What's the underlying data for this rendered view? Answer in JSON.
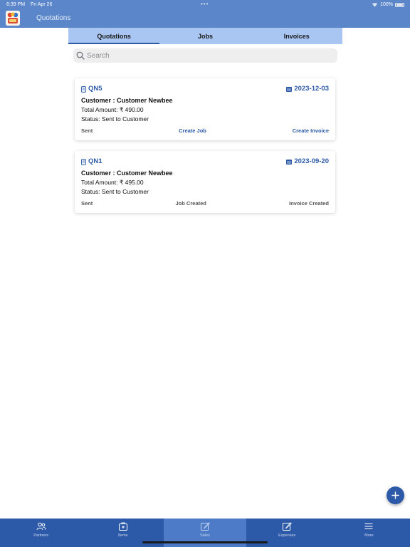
{
  "status_bar": {
    "time": "6:39 PM",
    "date": "Fri Apr 26",
    "battery": "100%"
  },
  "header": {
    "title": "Quotations"
  },
  "tabs": [
    {
      "label": "Quotations",
      "active": true
    },
    {
      "label": "Jobs",
      "active": false
    },
    {
      "label": "Invoices",
      "active": false
    }
  ],
  "search": {
    "placeholder": "Search",
    "value": ""
  },
  "quotations": [
    {
      "id": "QN5",
      "date": "2023-12-03",
      "customer": "Customer : Customer Newbee",
      "amount": "Total Amount: ₹ 490.00",
      "status": "Status: Sent to Customer",
      "footer_left": "Sent",
      "footer_mid": "Create Job",
      "footer_right": "Create Invoice"
    },
    {
      "id": "QN1",
      "date": "2023-09-20",
      "customer": "Customer : Customer Newbee",
      "amount": "Total Amount: ₹ 495.00",
      "status": "Status: Sent to Customer",
      "footer_left": "Sent",
      "footer_mid": "Job Created",
      "footer_right": "Invoice Created"
    }
  ],
  "bottom_nav": [
    {
      "label": "Partners",
      "icon": "partners-icon",
      "active": false
    },
    {
      "label": "Items",
      "icon": "items-icon",
      "active": false
    },
    {
      "label": "Sales",
      "icon": "sales-icon",
      "active": true
    },
    {
      "label": "Expenses",
      "icon": "expenses-icon",
      "active": false
    },
    {
      "label": "More",
      "icon": "menu-icon",
      "active": false
    }
  ],
  "colors": {
    "header": "#5b86c9",
    "accent": "#2d5aa8",
    "tab_bar": "#a9c6f2",
    "nav_bar": "#2d5aa8"
  }
}
